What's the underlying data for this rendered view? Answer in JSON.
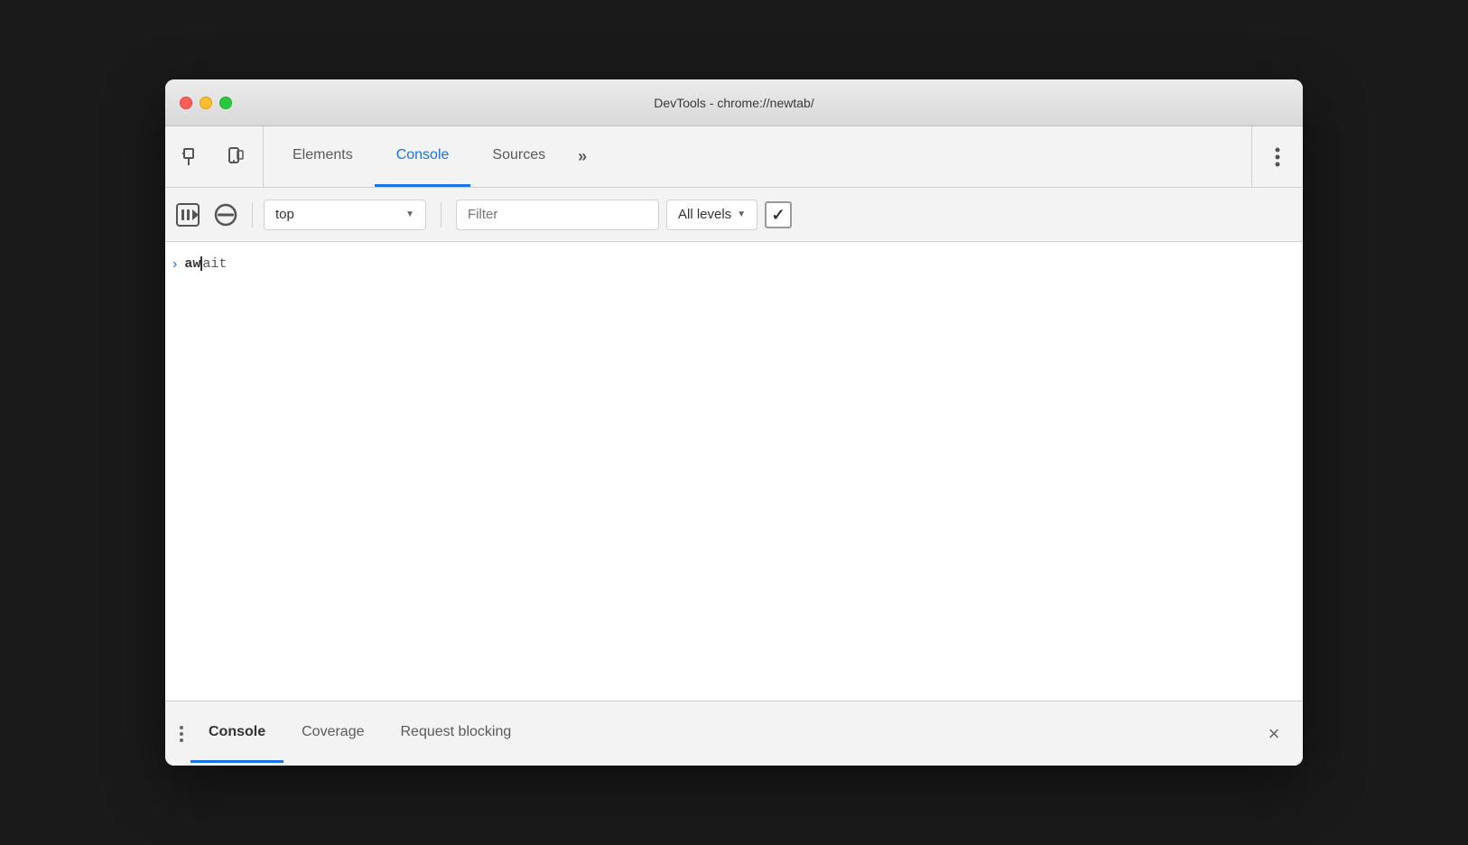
{
  "window": {
    "title": "DevTools - chrome://newtab/"
  },
  "traffic_lights": {
    "close": "close",
    "minimize": "minimize",
    "maximize": "maximize"
  },
  "top_toolbar": {
    "inspect_label": "inspect",
    "device_label": "device",
    "tabs": [
      {
        "id": "elements",
        "label": "Elements",
        "active": false
      },
      {
        "id": "console",
        "label": "Console",
        "active": true
      },
      {
        "id": "sources",
        "label": "Sources",
        "active": false
      }
    ],
    "more_tabs_label": "»",
    "more_options_label": "⋮"
  },
  "console_toolbar": {
    "play_pause_label": "play-pause",
    "no_entry_label": "no-entry",
    "context_value": "top",
    "context_placeholder": "top",
    "filter_placeholder": "Filter",
    "levels_label": "All levels",
    "checkbox_checked": true
  },
  "console_content": {
    "lines": [
      {
        "arrow": ">",
        "text_bold": "aw",
        "text_cursor": true,
        "text_light": "ait"
      }
    ]
  },
  "bottom_panel": {
    "tabs": [
      {
        "id": "console",
        "label": "Console",
        "active": true
      },
      {
        "id": "coverage",
        "label": "Coverage",
        "active": false
      },
      {
        "id": "request-blocking",
        "label": "Request blocking",
        "active": false
      }
    ],
    "close_label": "×"
  }
}
